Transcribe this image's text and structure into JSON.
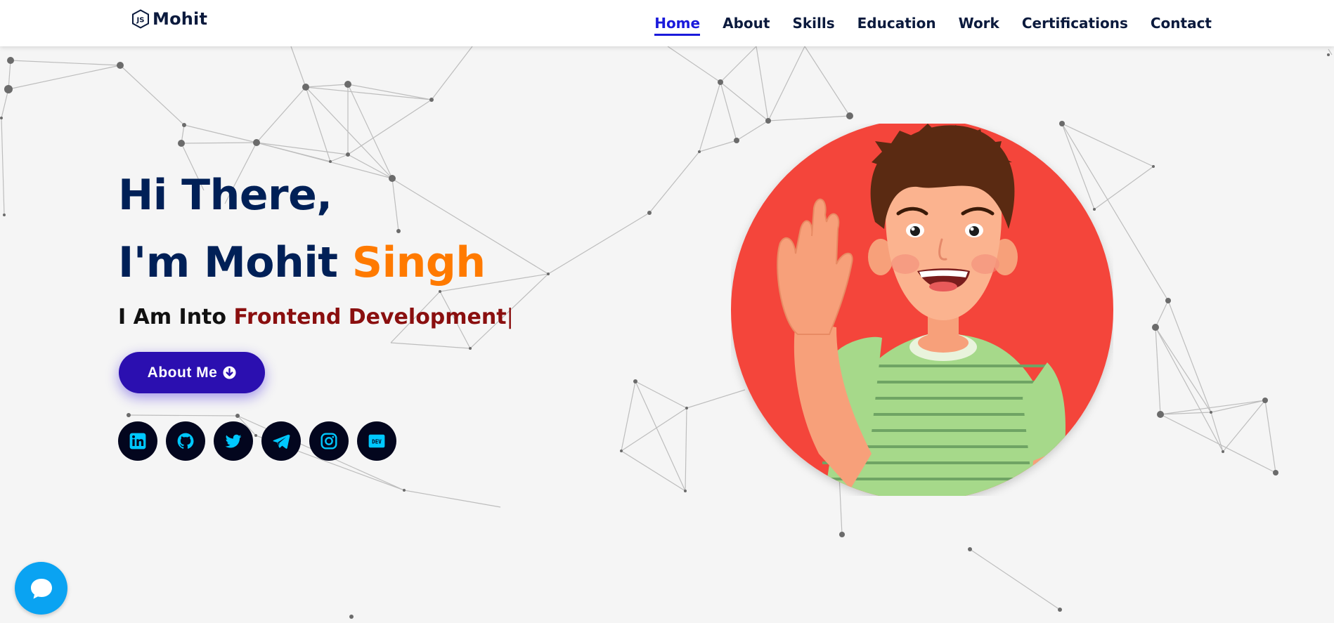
{
  "brand": {
    "name": "Mohit",
    "logo_icon": "js-hexagon-icon"
  },
  "nav": {
    "items": [
      {
        "label": "Home",
        "active": true
      },
      {
        "label": "About",
        "active": false
      },
      {
        "label": "Skills",
        "active": false
      },
      {
        "label": "Education",
        "active": false
      },
      {
        "label": "Work",
        "active": false
      },
      {
        "label": "Certifications",
        "active": false
      },
      {
        "label": "Contact",
        "active": false
      }
    ],
    "active_color": "#1a1adb"
  },
  "hero": {
    "greeting": "Hi There,",
    "intro_prefix": "I'm Mohit ",
    "intro_surname": "Singh",
    "typed_prefix": "I Am Into ",
    "typed_text": "Frontend Development",
    "cursor": "|",
    "button_label": "About Me",
    "button_icon": "arrow-circle-down-icon"
  },
  "socials": [
    {
      "name": "linkedin-icon"
    },
    {
      "name": "github-icon"
    },
    {
      "name": "twitter-icon"
    },
    {
      "name": "telegram-icon"
    },
    {
      "name": "instagram-icon"
    },
    {
      "name": "dev-icon",
      "label": "DEV"
    }
  ],
  "colors": {
    "heading": "#002057",
    "surname": "#ff7a00",
    "typed": "#8a0f0f",
    "button": "#2b0fb0",
    "social_bg": "#03061e",
    "social_icon": "#00c8ff",
    "avatar_bg": "#f4443a",
    "chat": "#0aa3f2"
  },
  "chat_widget": {
    "icon": "chat-bubble-icon"
  }
}
